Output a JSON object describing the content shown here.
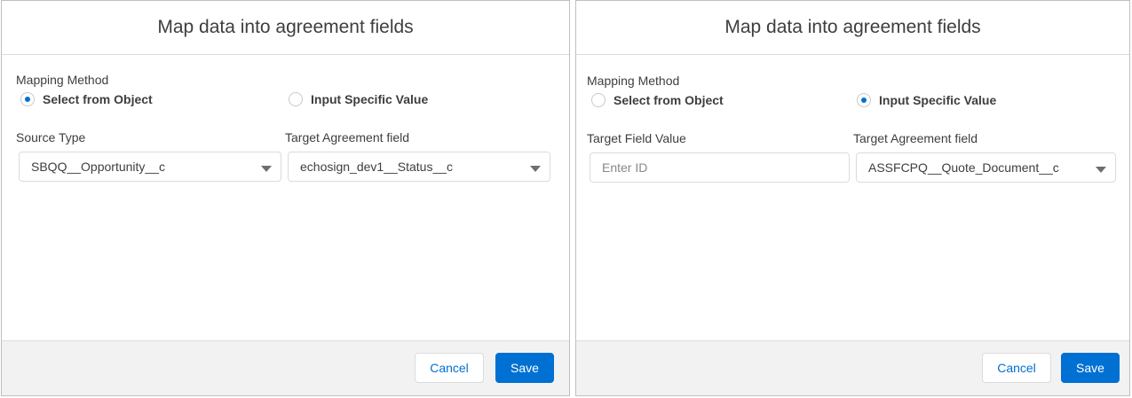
{
  "left_modal": {
    "title": "Map data into agreement fields",
    "mapping_method_label": "Mapping Method",
    "radio_options": [
      {
        "label": "Select from Object",
        "checked": true
      },
      {
        "label": "Input Specific Value",
        "checked": false
      }
    ],
    "source_type": {
      "label": "Source Type",
      "value": "SBQQ__Opportunity__c"
    },
    "target_field": {
      "label": "Target Agreement field",
      "value": "echosign_dev1__Status__c"
    },
    "footer": {
      "cancel_label": "Cancel",
      "save_label": "Save"
    }
  },
  "right_modal": {
    "title": "Map data into agreement fields",
    "mapping_method_label": "Mapping Method",
    "radio_options": [
      {
        "label": "Select from Object",
        "checked": false
      },
      {
        "label": "Input Specific Value",
        "checked": true
      }
    ],
    "target_field_value": {
      "label": "Target Field Value",
      "placeholder": "Enter ID"
    },
    "target_field": {
      "label": "Target Agreement field",
      "value": "ASSFCPQ__Quote_Document__c"
    },
    "footer": {
      "cancel_label": "Cancel",
      "save_label": "Save"
    }
  },
  "colors": {
    "accent": "#0070d2",
    "footer_bg": "#f3f2f2",
    "border": "#dddbda",
    "text": "#3e3e3c"
  },
  "icons": [
    "radio-checked-icon",
    "radio-unchecked-icon",
    "dropdown-caret-icon"
  ]
}
